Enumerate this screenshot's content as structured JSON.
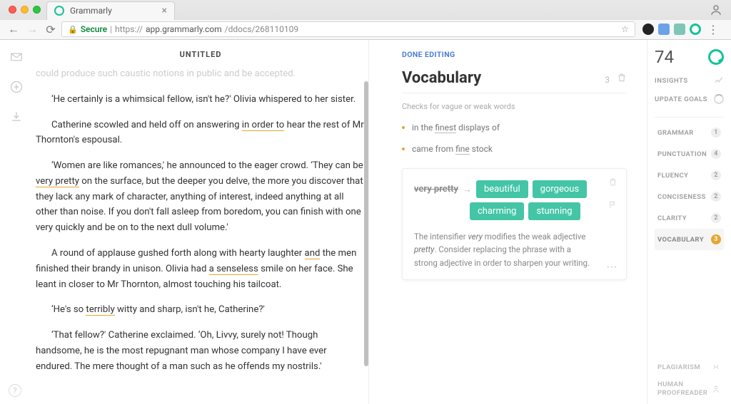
{
  "browser": {
    "tab_title": "Grammarly",
    "secure_label": "Secure",
    "url_prefix": "https://",
    "url_host": "app.grammarly.com",
    "url_path": "/ddocs/268110109"
  },
  "doc": {
    "title": "UNTITLED",
    "paragraphs": {
      "p0": "could produce such caustic notions in public and be accepted.",
      "p1a": "‘He certainly is a whimsical fellow, isn't he?' Olivia whispered to her sister.",
      "p2a": "Catherine scowled and held off on answering ",
      "p2hl": "in order to",
      "p2b": " hear the rest of Mr Thornton's espousal.",
      "p3a": "‘Women are like romances,' he announced to the eager crowd. ‘They can be ",
      "p3hl": "very pretty",
      "p3b": " on the surface, but the deeper you delve, the more you discover that they lack any mark of character, anything of interest, indeed anything at all other than noise. If you don't fall asleep from boredom, you can finish with one very quickly and be on to the next dull volume.'",
      "p4a": "A round of applause gushed forth along with hearty laughter ",
      "p4hl1": "and",
      "p4b": " the men finished their brandy in unison. Olivia had ",
      "p4hl2": "a senseless",
      "p4c": " smile on her face. She leant in closer to Mr Thornton, almost touching his tailcoat.",
      "p5a": "‘He's so ",
      "p5hl": "terribly",
      "p5b": " witty and sharp, isn't he, Catherine?'",
      "p6": "‘That fellow?' Catherine exclaimed. ‘Oh, Livvy, surely not! Though handsome, he is the most repugnant man whose company I have ever endured. The mere thought of a man such as he offends my nostrils.'"
    }
  },
  "panel": {
    "done_editing": "DONE EDITING",
    "category_title": "Vocabulary",
    "category_count": "3",
    "category_sub": "Checks for vague or weak words",
    "issues": [
      {
        "pre": "in the ",
        "word": "finest",
        "post": " displays of"
      },
      {
        "pre": "came from ",
        "word": "fine",
        "post": " stock"
      }
    ],
    "card": {
      "original": "very pretty",
      "suggestions": [
        "beautiful",
        "gorgeous",
        "charming",
        "stunning"
      ],
      "body_1": "The intensifier ",
      "body_em1": "very",
      "body_2": " modifies the weak adjective ",
      "body_em2": "pretty",
      "body_3": ". Consider replacing the phrase with a strong adjective in order to sharpen your writing."
    }
  },
  "right": {
    "score": "74",
    "insights_label": "INSIGHTS",
    "goals_label": "UPDATE GOALS",
    "categories": [
      {
        "label": "GRAMMAR",
        "count": "1"
      },
      {
        "label": "PUNCTUATION",
        "count": "4"
      },
      {
        "label": "FLUENCY",
        "count": "2"
      },
      {
        "label": "CONCISENESS",
        "count": "2"
      },
      {
        "label": "CLARITY",
        "count": "2"
      },
      {
        "label": "VOCABULARY",
        "count": "3"
      }
    ],
    "plagiarism": "PLAGIARISM",
    "proofreader": "HUMAN PROOFREADER"
  }
}
